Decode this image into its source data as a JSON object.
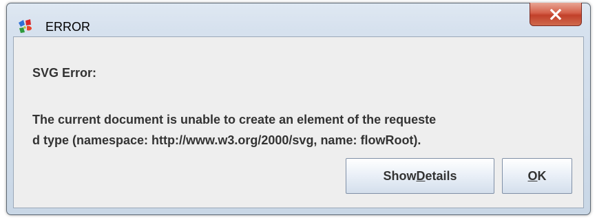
{
  "window": {
    "title": "ERROR",
    "icon": "app-error-icon",
    "close_icon": "close-x-icon"
  },
  "message": {
    "header": "SVG Error:",
    "line1": "The current document is unable to create an element of the requeste",
    "line2": "d type (namespace: http://www.w3.org/2000/svg, name: flowRoot)."
  },
  "buttons": {
    "details": {
      "prefix": "Show ",
      "mnemonic": "D",
      "suffix": "etails"
    },
    "ok": {
      "prefix": "",
      "mnemonic": "O",
      "suffix": "K"
    }
  },
  "colors": {
    "close_button": "#c84a33",
    "window_chrome": "#d6e1ee",
    "client_background": "#eeeeee",
    "text": "#333333"
  }
}
